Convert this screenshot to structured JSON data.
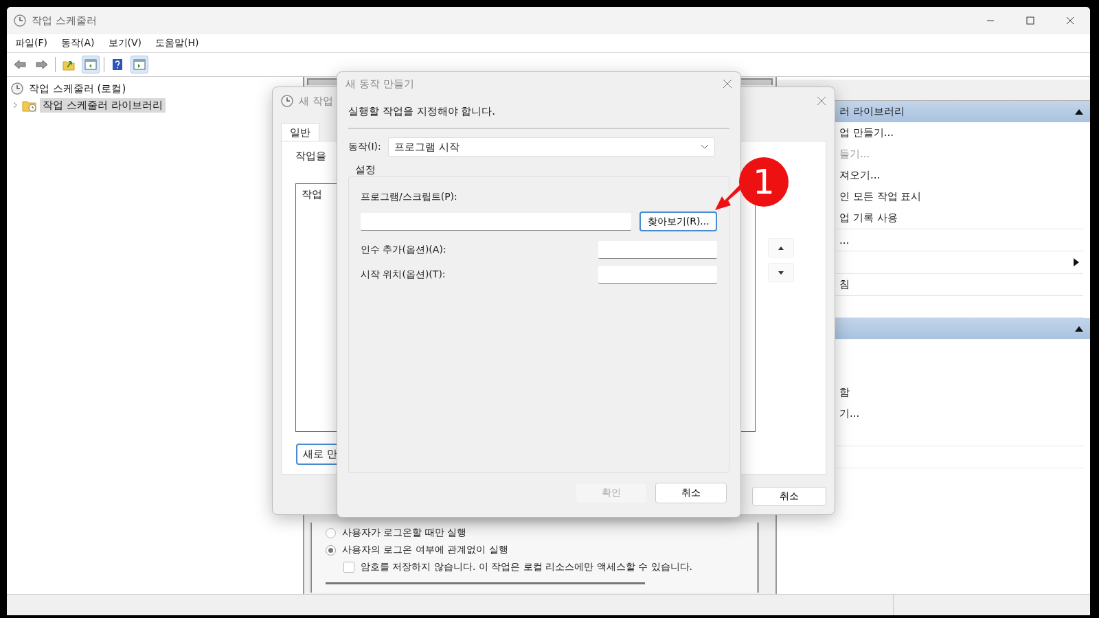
{
  "window": {
    "title": "작업 스케줄러"
  },
  "menu": [
    "파일(F)",
    "동작(A)",
    "보기(V)",
    "도움말(H)"
  ],
  "tree": [
    {
      "label": "작업 스케줄러 (로컬)",
      "selected": false,
      "children": [
        {
          "label": "작업 스케줄러 라이브러리",
          "selected": true,
          "expanded": false
        }
      ]
    }
  ],
  "task_options": {
    "radios": [
      {
        "label": "사용자가 로그온할 때만 실행",
        "selected": false
      },
      {
        "label": "사용자의 로그온 여부에 관계없이 실행",
        "selected": true
      }
    ],
    "checkbox": {
      "label": "암호를 저장하지 않습니다. 이 작업은 로컬 리소스에만 액세스할 수 있습니다.",
      "checked": false
    }
  },
  "actions": {
    "sections": [
      {
        "title": "러 라이브러리",
        "expanded": true,
        "groups": [
          [
            {
              "kind": "command",
              "label": "업 만들기...",
              "disabled": false
            },
            {
              "kind": "command",
              "label": "들기...",
              "disabled": true
            },
            {
              "kind": "command",
              "label": "져오기...",
              "disabled": false
            },
            {
              "kind": "command",
              "label": "인 모든 작업 표시",
              "disabled": false
            },
            {
              "kind": "command",
              "label": "업 기록 사용",
              "disabled": false
            }
          ],
          [
            {
              "kind": "command",
              "label": "...",
              "disabled": false
            }
          ],
          [
            {
              "kind": "submenu"
            }
          ],
          [
            {
              "kind": "command",
              "label": "침",
              "disabled": false
            }
          ],
          [
            {
              "kind": "blank"
            }
          ]
        ]
      },
      {
        "expanded": true,
        "groups": [
          [
            {
              "kind": "blank"
            },
            {
              "kind": "blank"
            },
            {
              "kind": "command",
              "label": "함",
              "disabled": false
            },
            {
              "kind": "command",
              "label": "기...",
              "disabled": false
            },
            {
              "kind": "blank"
            }
          ],
          [
            {
              "kind": "blank"
            }
          ]
        ]
      }
    ]
  },
  "task_dialog": {
    "title": "새 작업",
    "tabs": [
      {
        "label": "일반",
        "selected": true
      }
    ],
    "description": "작업을",
    "list": {
      "column": "작업"
    },
    "new_button": "새로 만",
    "cancel_button": "취소"
  },
  "action_dialog": {
    "title": "새 동작 만들기",
    "instruction": "실행할 작업을 지정해야 합니다.",
    "action": {
      "label": "동작(I):",
      "value": "프로그램 시작"
    },
    "group": {
      "title": "설정",
      "program": {
        "label": "프로그램/스크립트(P):",
        "browse_button": "찾아보기(R)..."
      },
      "arguments": {
        "label": "인수 추가(옵션)(A):"
      },
      "start_in": {
        "label": "시작 위치(옵션)(T):"
      }
    },
    "buttons": [
      {
        "label": "확인",
        "disabled": true
      },
      {
        "label": "취소",
        "disabled": false
      }
    ]
  },
  "callout": {
    "number": "1"
  }
}
